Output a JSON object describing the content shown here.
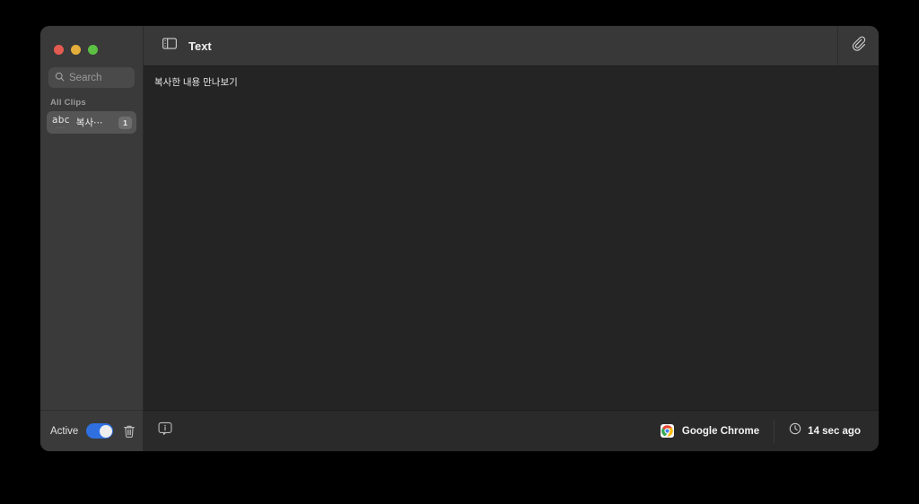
{
  "window": {
    "traffic_lights": [
      {
        "name": "close",
        "color": "#e45b52"
      },
      {
        "name": "minimize",
        "color": "#e5ae3a"
      },
      {
        "name": "maximize",
        "color": "#5cc043"
      }
    ]
  },
  "sidebar": {
    "search": {
      "value": "",
      "placeholder": "Search",
      "icon": "search-icon"
    },
    "section_label": "All Clips",
    "clips": [
      {
        "type_icon_label": "abc",
        "type_icon_dots": "......",
        "title": "복사⋯",
        "badge": "1"
      }
    ],
    "footer": {
      "active_label": "Active",
      "toggle_on": true,
      "toggle_color": "#2f6fe0",
      "trash_icon": "trash-icon"
    }
  },
  "main": {
    "header": {
      "sidebar_toggle_icon": "sidebar-toggle-icon",
      "title": "Text",
      "attachment_icon": "paperclip-icon"
    },
    "content": {
      "text": "복사한 내용 만나보기"
    },
    "footer": {
      "info_icon": "info-icon",
      "app_name": "Google Chrome",
      "app_icon": "chrome-icon",
      "time_icon": "clock-icon",
      "time_text": "14 sec ago"
    }
  }
}
